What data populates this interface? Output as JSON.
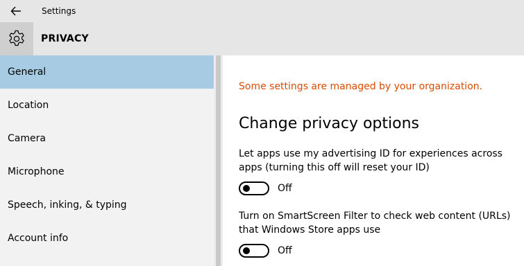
{
  "window": {
    "title": "Settings",
    "back_icon": "back-arrow-icon"
  },
  "header": {
    "icon": "gear-icon",
    "title": "PRIVACY"
  },
  "sidebar": {
    "items": [
      {
        "label": "General",
        "selected": true
      },
      {
        "label": "Location",
        "selected": false
      },
      {
        "label": "Camera",
        "selected": false
      },
      {
        "label": "Microphone",
        "selected": false
      },
      {
        "label": "Speech, inking, & typing",
        "selected": false
      },
      {
        "label": "Account info",
        "selected": false
      }
    ]
  },
  "main": {
    "notice": "Some settings are managed by your organization.",
    "section_title": "Change privacy options",
    "settings": [
      {
        "description": "Let apps use my advertising ID for experiences across apps (turning this off will reset your ID)",
        "state": "Off",
        "enabled": false
      },
      {
        "description": "Turn on SmartScreen Filter to check web content (URLs) that Windows Store apps use",
        "state": "Off",
        "enabled": false
      }
    ]
  },
  "colors": {
    "accent_selected": "#a6cbe3",
    "notice": "#d84b00",
    "titlebar": "#e6e6e6",
    "sidebar": "#f2f2f2"
  }
}
